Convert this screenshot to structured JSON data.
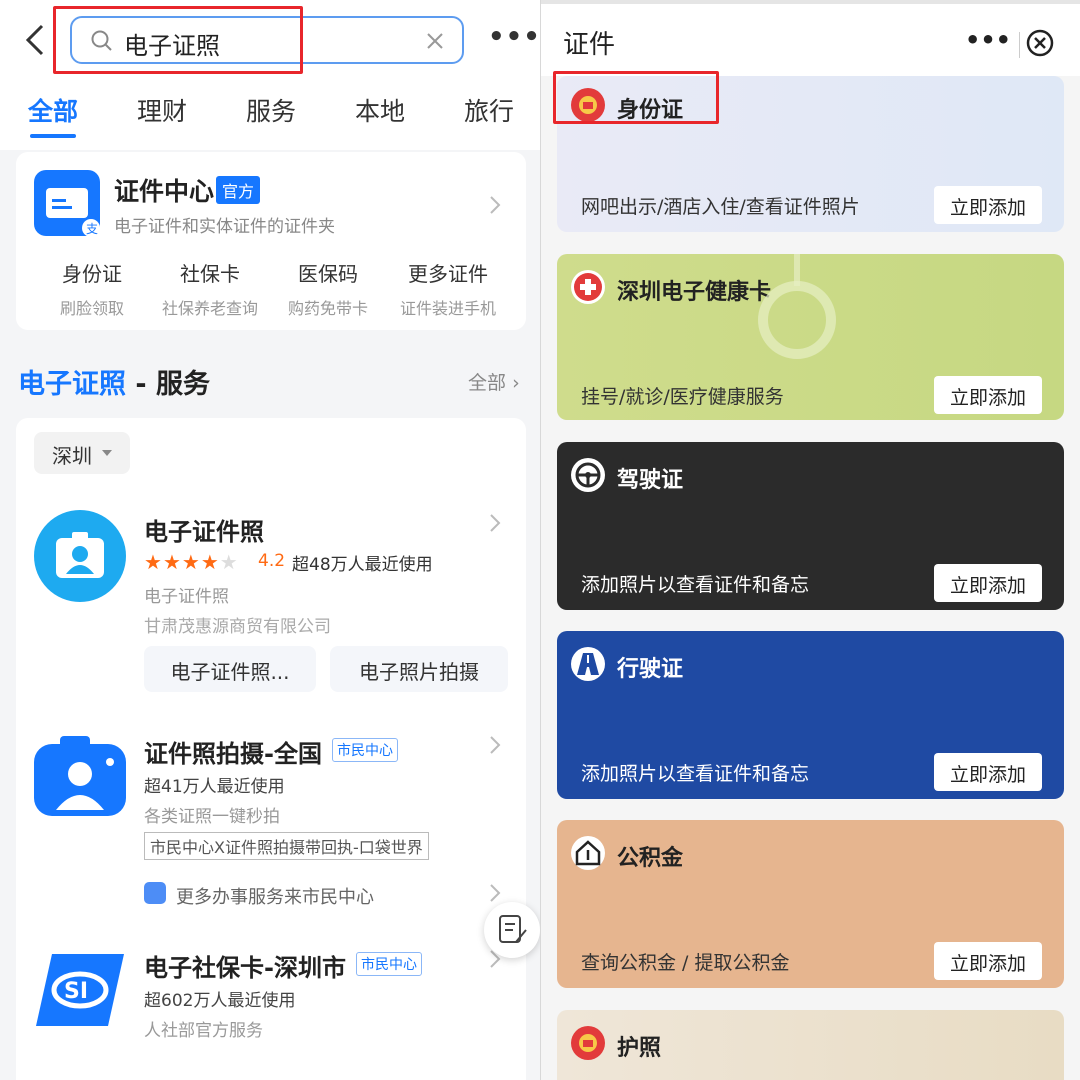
{
  "left": {
    "search": {
      "value": "电子证照"
    },
    "more_label": "•••",
    "tabs": [
      "全部",
      "理财",
      "服务",
      "本地",
      "旅行"
    ],
    "cert_center": {
      "title": "证件中心",
      "badge": "官方",
      "subtitle": "电子证件和实体证件的证件夹",
      "items": [
        {
          "title": "身份证",
          "sub": "刷脸领取"
        },
        {
          "title": "社保卡",
          "sub": "社保养老查询"
        },
        {
          "title": "医保码",
          "sub": "购药免带卡"
        },
        {
          "title": "更多证件",
          "sub": "证件装进手机"
        }
      ]
    },
    "section": {
      "highlight": "电子证照",
      "rest": " - 服务",
      "all": "全部"
    },
    "city": "深圳",
    "apps": [
      {
        "title": "电子证件照",
        "rating": "4.2",
        "users": "超48万人最近使用",
        "desc": "电子证件照",
        "company": "甘肃茂惠源商贸有限公司",
        "buttons": [
          "电子证件照...",
          "电子照片拍摄"
        ]
      },
      {
        "title": "证件照拍摄-全国",
        "tag": "市民中心",
        "users": "超41万人最近使用",
        "desc": "各类证照一键秒拍",
        "boxed_tag": "市民中心X证件照拍摄带回执-口袋世界",
        "service_link": "更多办事服务来市民中心"
      },
      {
        "title": "电子社保卡-深圳市",
        "tag": "市民中心",
        "users": "超602万人最近使用",
        "desc": "人社部官方服务"
      }
    ]
  },
  "right": {
    "title": "证件",
    "more_label": "•••",
    "add_label": "立即添加",
    "cards": [
      {
        "name": "身份证",
        "desc": "网吧出示/酒店入住/查看证件照片"
      },
      {
        "name": "深圳电子健康卡",
        "desc": "挂号/就诊/医疗健康服务"
      },
      {
        "name": "驾驶证",
        "desc": "添加照片以查看证件和备忘"
      },
      {
        "name": "行驶证",
        "desc": "添加照片以查看证件和备忘"
      },
      {
        "name": "公积金",
        "desc": "查询公积金 / 提取公积金"
      },
      {
        "name": "护照",
        "desc": ""
      }
    ]
  },
  "colors": {
    "accent": "#1677ff",
    "highlight_box": "#e8262b",
    "star": "#ff6a13"
  }
}
